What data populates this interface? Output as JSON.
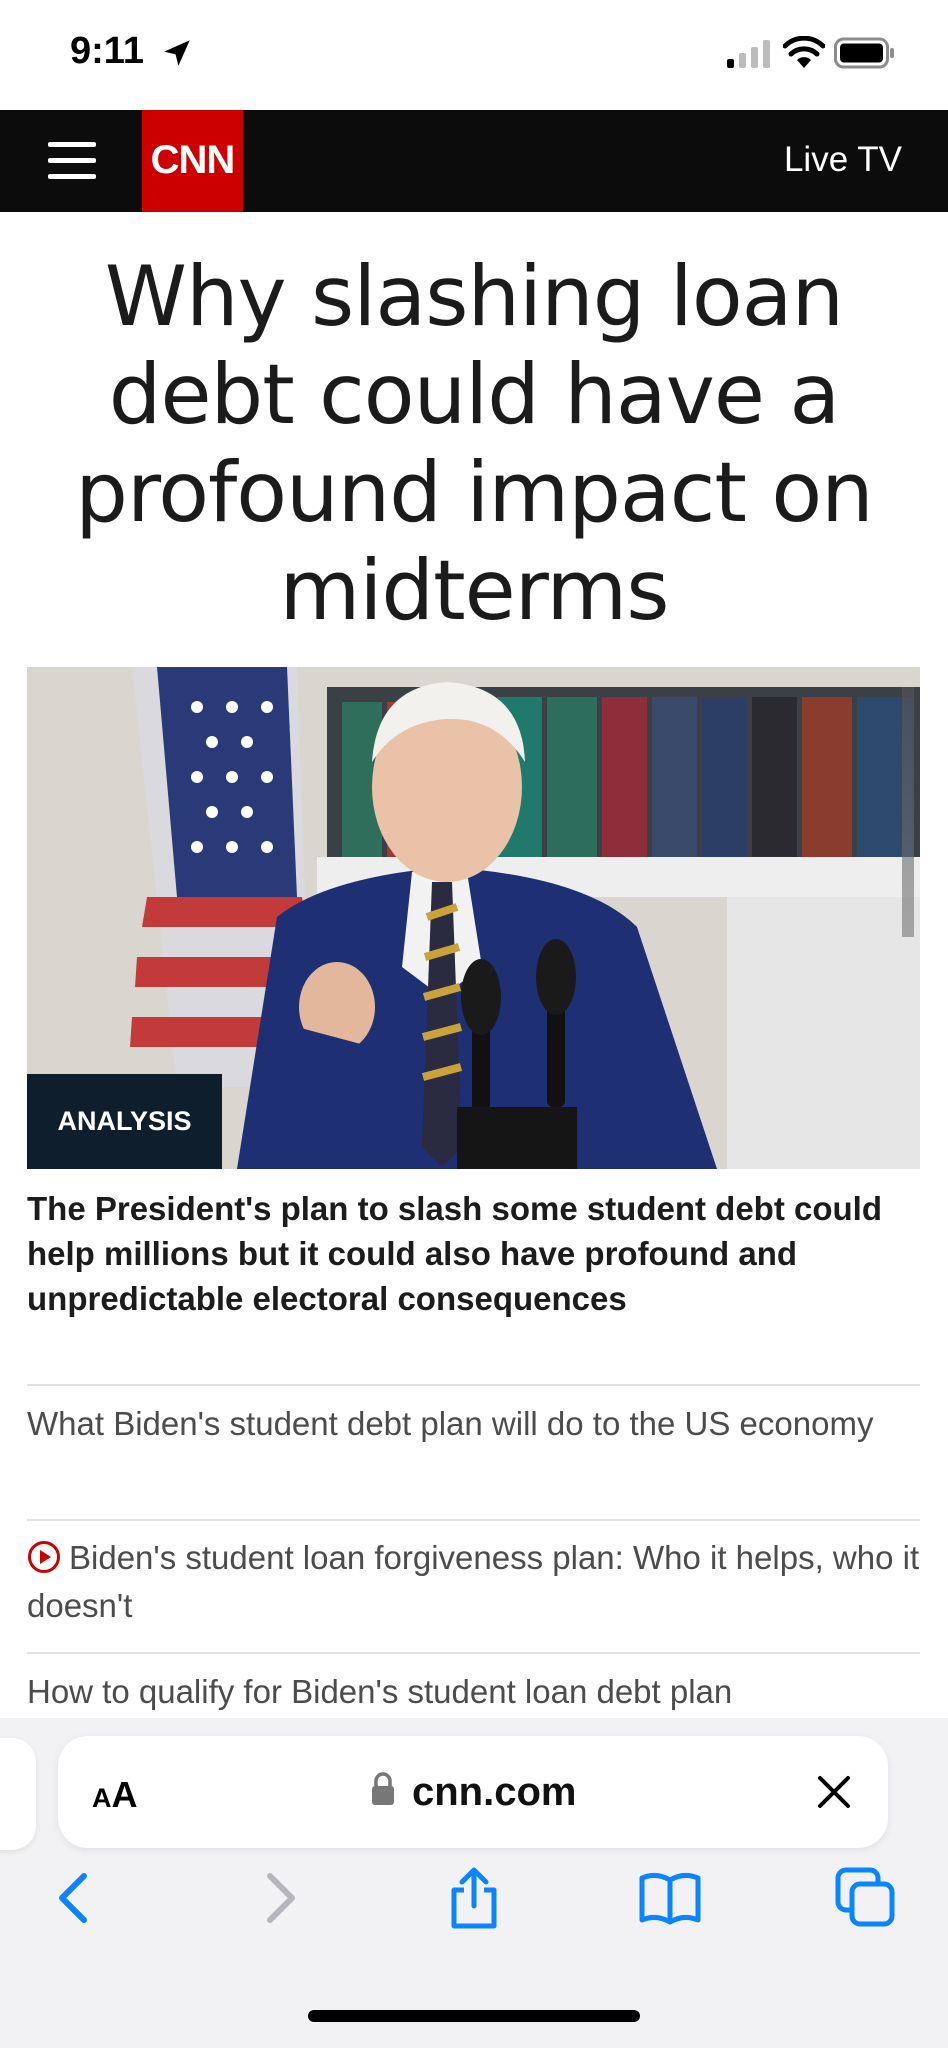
{
  "status": {
    "time": "9:11"
  },
  "nav": {
    "logo": "CNN",
    "live_tv": "Live TV"
  },
  "article": {
    "headline": "Why slashing loan debt could have a profound impact on midterms",
    "badge": "ANALYSIS",
    "summary": "The President's plan to slash some student debt could help millions but it could also have profound and unpredictable electoral consequences"
  },
  "related": [
    {
      "text": "What Biden's student debt plan will do to the US economy"
    },
    {
      "text": "Biden's student loan forgiveness plan: Who it helps, who it doesn't"
    },
    {
      "text": "How to qualify for Biden's student loan debt plan"
    }
  ],
  "browser": {
    "aa_big": "A",
    "aa_small": "A",
    "url": "cnn.com"
  },
  "colors": {
    "brand_red": "#cc0000",
    "nav_bg": "#0c0c0c",
    "safari_blue": "#0a84ff"
  }
}
